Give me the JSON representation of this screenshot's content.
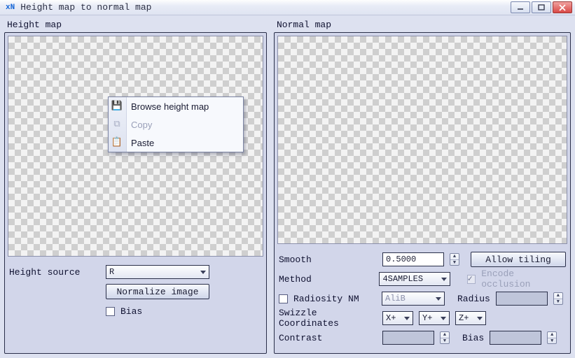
{
  "window": {
    "app_icon_text": "xN",
    "title": "Height map to normal map"
  },
  "left": {
    "panel_label": "Height map",
    "height_source_label": "Height source",
    "height_source_value": "R",
    "normalize_button": "Normalize image",
    "bias_label": "Bias"
  },
  "right": {
    "panel_label": "Normal map",
    "smooth_label": "Smooth",
    "smooth_value": "0.5000",
    "allow_tiling_button": "Allow tiling",
    "method_label": "Method",
    "method_value": "4SAMPLES",
    "encode_occlusion_label": "Encode occlusion",
    "radiosity_label": "Radiosity NM",
    "radiosity_value": "AliB",
    "radius_label": "Radius",
    "radius_value": "",
    "swizzle_label": "Swizzle Coordinates",
    "swizzle_x": "X+",
    "swizzle_y": "Y+",
    "swizzle_z": "Z+",
    "contrast_label": "Contrast",
    "contrast_value": "",
    "bias_label": "Bias",
    "bias_value": ""
  },
  "context_menu": {
    "browse": "Browse height map",
    "copy": "Copy",
    "paste": "Paste"
  }
}
